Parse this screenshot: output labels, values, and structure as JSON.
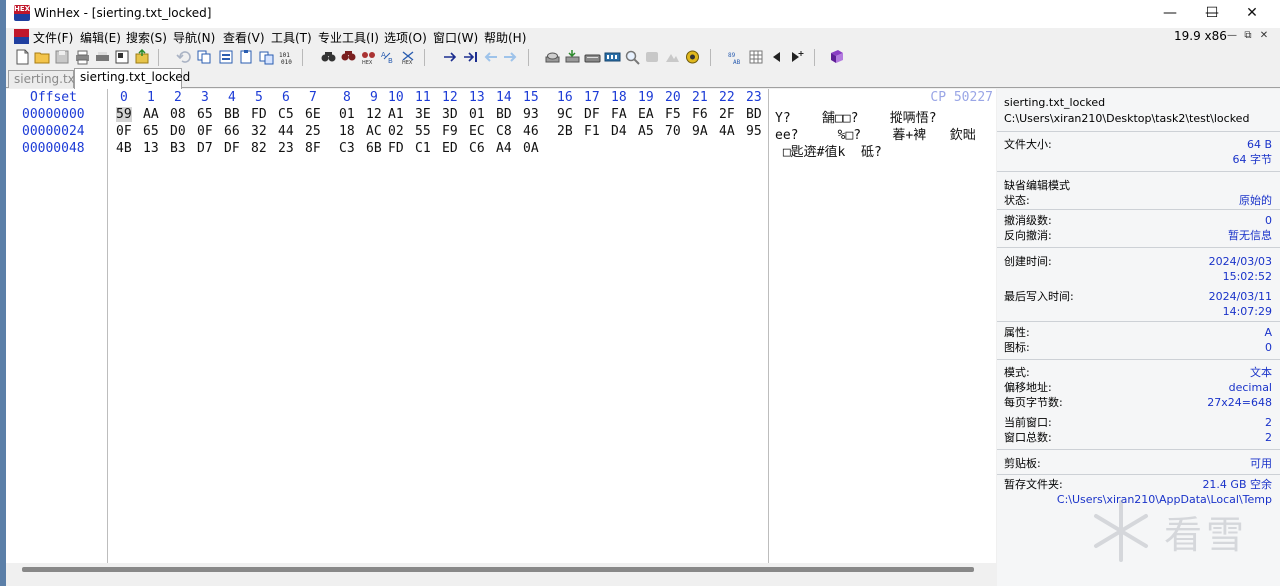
{
  "window": {
    "title": "WinHex - [sierting.txt_locked]",
    "logo_text": "HEX",
    "controls": [
      "—",
      "☐",
      "✕"
    ]
  },
  "menu": {
    "items": [
      "文件(F)",
      "编辑(E)",
      "搜索(S)",
      "导航(N)",
      "查看(V)",
      "工具(T)",
      "专业工具(I)",
      "选项(O)",
      "窗口(W)",
      "帮助(H)"
    ],
    "zoom_readout": "19.9 x86",
    "mdi_controls": [
      "—",
      "⧉",
      "✕"
    ]
  },
  "tabs": [
    {
      "label": "sierting.txt",
      "active": false
    },
    {
      "label": "sierting.txt_locked",
      "active": true
    }
  ],
  "editor": {
    "offset_header": "Offset",
    "column_headers": [
      "0",
      "1",
      "2",
      "3",
      "4",
      "5",
      "6",
      "7",
      "8",
      "9",
      "10",
      "11",
      "12",
      "13",
      "14",
      "15",
      "16",
      "17",
      "18",
      "19",
      "20",
      "21",
      "22",
      "23"
    ],
    "codepage": "CP 50227",
    "rows": [
      {
        "offset": "00000000",
        "bytes": [
          "59",
          "AA",
          "08",
          "65",
          "BB",
          "FD",
          "C5",
          "6E",
          "01",
          "12",
          "A1",
          "3E",
          "3D",
          "01",
          "BD",
          "93",
          "9C",
          "DF",
          "FA",
          "EA",
          "F5",
          "F6",
          "2F",
          "BD"
        ],
        "text": "Y?    舗□□?    摐唡悟?"
      },
      {
        "offset": "00000024",
        "bytes": [
          "0F",
          "65",
          "D0",
          "0F",
          "66",
          "32",
          "44",
          "25",
          "18",
          "AC",
          "02",
          "55",
          "F9",
          "EC",
          "C8",
          "46",
          "2B",
          "F1",
          "D4",
          "A5",
          "70",
          "9A",
          "4A",
          "95"
        ],
        "text": "ee?     %□?    萶+裨   欽昢"
      },
      {
        "offset": "00000048",
        "bytes": [
          "4B",
          "13",
          "B3",
          "D7",
          "DF",
          "82",
          "23",
          "8F",
          "C3",
          "6B",
          "FD",
          "C1",
          "ED",
          "C6",
          "A4",
          "0A"
        ],
        "text": " □匙逩#徝k  砥?"
      }
    ],
    "cursor_offset": "00000000"
  },
  "info_panel": {
    "file_name": "sierting.txt_locked",
    "file_path": "C:\\Users\\xiran210\\Desktop\\task2\\test\\locked",
    "file_size_label": "文件大小:",
    "file_size_bytes": "64 B",
    "file_size_chars": "64 字节",
    "default_edit_mode": "缺省编辑模式",
    "state_label": "状态:",
    "state_value": "原始的",
    "undo_level_label": "撤消级数:",
    "undo_level_value": "0",
    "undo_reverse_label": "反向撤消:",
    "undo_reverse_value": "暂无信息",
    "created_label": "创建时间:",
    "created_date": "2024/03/03",
    "created_time": "15:02:52",
    "modified_label": "最后写入时间:",
    "modified_date": "2024/03/11",
    "modified_time": "14:07:29",
    "attr_label": "属性:",
    "attr_value": "A",
    "icon_label": "图标:",
    "icon_value": "0",
    "mode_label": "模式:",
    "mode_value": "文本",
    "offset_addr_label": "偏移地址:",
    "offset_addr_value": "decimal",
    "bytes_per_page_label": "每页字节数:",
    "bytes_per_page_value": "27x24=648",
    "current_window_label": "当前窗口:",
    "current_window_value": "2",
    "total_windows_label": "窗口总数:",
    "total_windows_value": "2",
    "clipboard_label": "剪贴板:",
    "clipboard_value": "可用",
    "temp_label": "暂存文件夹:",
    "temp_free": "21.4 GB 空余",
    "temp_path": "C:\\Users\\xiran210\\AppData\\Local\\Temp"
  },
  "watermark": {
    "text": "看雪"
  },
  "colors": {
    "offset_blue": "#1c3bd6",
    "value_blue": "#1a33c9",
    "codepage": "#9aa6e6"
  }
}
